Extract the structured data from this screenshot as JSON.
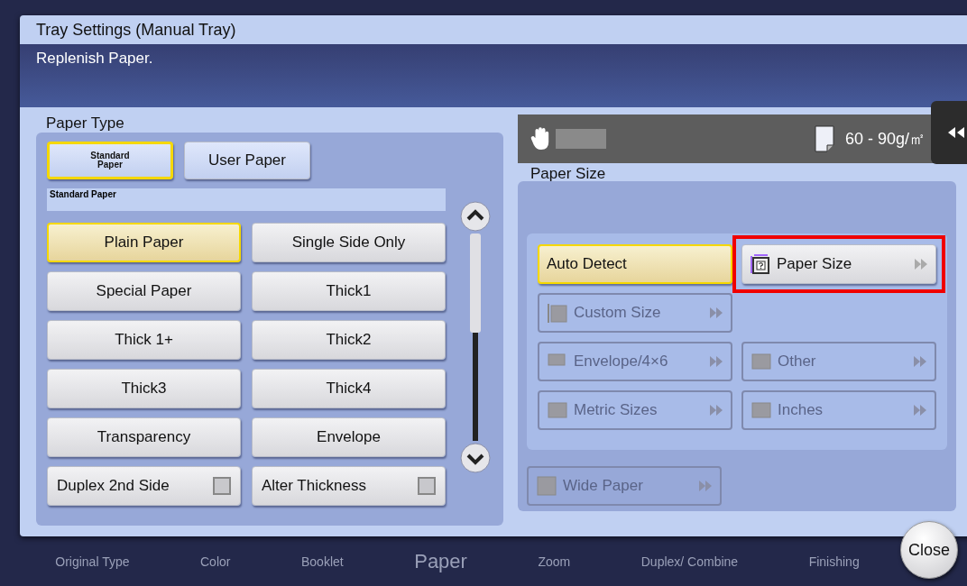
{
  "dialog": {
    "title": "Tray Settings (Manual Tray)",
    "message": "Replenish Paper."
  },
  "paper_type": {
    "label": "Paper Type",
    "tabs": [
      {
        "label": "Standard Paper",
        "selected": true,
        "kind": "small"
      },
      {
        "label": "User Paper",
        "selected": false,
        "kind": "normal"
      }
    ],
    "caption": "Standard Paper",
    "options": [
      {
        "label": "Plain Paper",
        "selected": true,
        "kind": "button"
      },
      {
        "label": "Single Side Only",
        "selected": false,
        "kind": "button"
      },
      {
        "label": "Special Paper",
        "selected": false,
        "kind": "button"
      },
      {
        "label": "Thick1",
        "selected": false,
        "kind": "button"
      },
      {
        "label": "Thick 1+",
        "selected": false,
        "kind": "button"
      },
      {
        "label": "Thick2",
        "selected": false,
        "kind": "button"
      },
      {
        "label": "Thick3",
        "selected": false,
        "kind": "button"
      },
      {
        "label": "Thick4",
        "selected": false,
        "kind": "button"
      },
      {
        "label": "Transparency",
        "selected": false,
        "kind": "button"
      },
      {
        "label": "Envelope",
        "selected": false,
        "kind": "button"
      },
      {
        "label": "Duplex 2nd Side",
        "checked": false,
        "kind": "checkbox"
      },
      {
        "label": "Alter Thickness",
        "checked": false,
        "kind": "checkbox"
      }
    ]
  },
  "tray_info": {
    "weight": "60 - 90g/㎡"
  },
  "paper_size": {
    "label": "Paper Size",
    "options": [
      {
        "label": "Auto Detect",
        "selected": true,
        "disabled": false,
        "kind": "plain"
      },
      {
        "label": "Paper Size",
        "selected": false,
        "disabled": false,
        "kind": "unknown",
        "highlighted": true
      },
      {
        "label": "Custom Size",
        "selected": false,
        "disabled": true,
        "kind": "custom"
      },
      {
        "label": "Envelope/4×6",
        "selected": false,
        "disabled": true,
        "kind": "envelope"
      },
      {
        "label": "Other",
        "selected": false,
        "disabled": true,
        "kind": "group"
      },
      {
        "label": "Metric Sizes",
        "selected": false,
        "disabled": true,
        "kind": "group"
      },
      {
        "label": "Inches",
        "selected": false,
        "disabled": true,
        "kind": "group"
      }
    ],
    "wide_paper": {
      "label": "Wide Paper",
      "disabled": true
    }
  },
  "close_button": "Close",
  "background_bar": [
    {
      "label": "Original Type",
      "kind": "small"
    },
    {
      "label": "Color",
      "kind": "small"
    },
    {
      "label": "Booklet",
      "kind": "small"
    },
    {
      "label": "Paper",
      "kind": "large"
    },
    {
      "label": "Zoom",
      "kind": "small"
    },
    {
      "label": "Duplex/ Combine",
      "kind": "small"
    },
    {
      "label": "Finishing",
      "kind": "small"
    }
  ]
}
